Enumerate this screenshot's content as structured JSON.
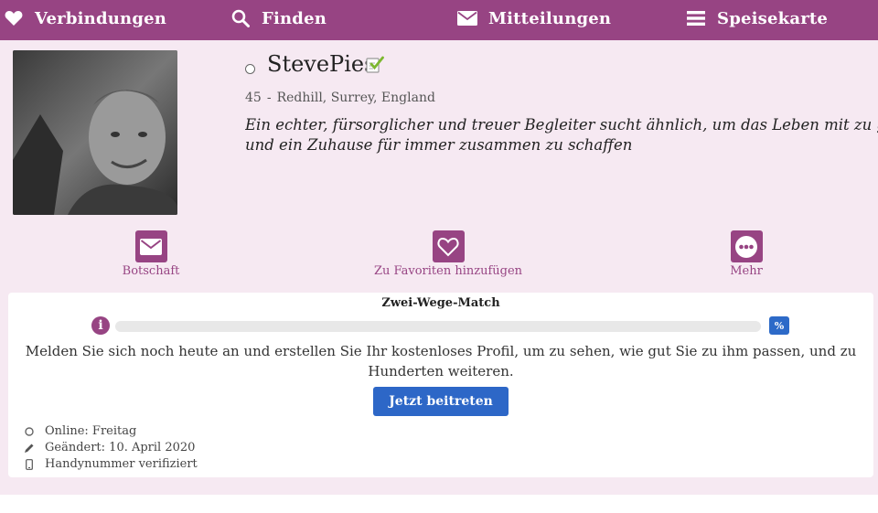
{
  "nav": {
    "connections": {
      "label": "Verbindungen",
      "icon": "heart-icon"
    },
    "find": {
      "label": "Finden",
      "icon": "search-icon"
    },
    "messages": {
      "label": "Mitteilungen",
      "icon": "envelope-icon"
    },
    "menu": {
      "label": "Speisekarte",
      "icon": "hamburger-icon"
    }
  },
  "profile": {
    "username": "StevePies",
    "age": "45",
    "separator": "-",
    "location": "Redhill, Surrey, England",
    "tagline_line1": "Ein echter, fürsorglicher und treuer Begleiter sucht ähnlich, um das Leben mit zu genieß",
    "tagline_line2": "und ein Zuhause für immer zusammen zu schaffen"
  },
  "actions": {
    "message": {
      "label": "Botschaft",
      "icon": "envelope-icon"
    },
    "favorite": {
      "label": "Zu Favoriten hinzufügen",
      "icon": "heart-outline-icon"
    },
    "more": {
      "label": "Mehr",
      "icon": "more-dots-icon"
    }
  },
  "match": {
    "title": "Zwei-Wege-Match",
    "info_symbol": "i",
    "percent_symbol": "%",
    "progress": 0,
    "join_text": "Melden Sie sich noch heute an und erstellen Sie Ihr kostenloses Profil, um zu sehen, wie gut Sie zu ihm passen, und zu Hunderten weiteren.",
    "join_button": "Jetzt beitreten"
  },
  "meta": {
    "online": "Online: Freitag",
    "changed": "Geändert: 10. April 2020",
    "phone": "Handynummer verifiziert"
  },
  "colors": {
    "brand": "#974483",
    "background": "#f6e9f2",
    "button_blue": "#2d67c7",
    "verified_green": "#7cb82f"
  }
}
